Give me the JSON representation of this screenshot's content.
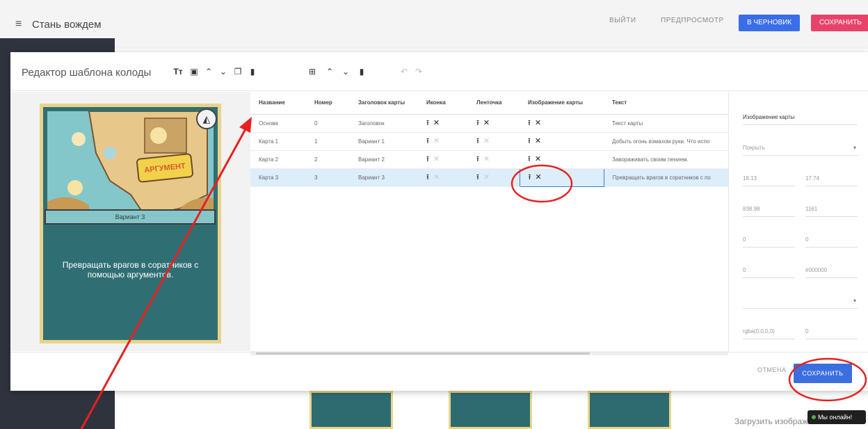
{
  "app": {
    "menu_icon": "menu-icon",
    "title": "Стань вождем",
    "exit_label": "ВЫЙТИ",
    "preview_label": "ПРЕДПРОСМОТР",
    "draft_label": "В ЧЕРНОВИК",
    "save_label": "СОХРАНИТЬ",
    "draft_color": "#3a6ee8",
    "save_color": "#e8426b"
  },
  "background": {
    "upload_caption": "Загрузить изображение",
    "chat_badge": "Мы онлайн!"
  },
  "modal": {
    "title": "Редактор шаблона колоды",
    "toolbar_left": [
      "text-format-icon",
      "image-icon",
      "move-up-icon",
      "move-down-icon",
      "copy-icon",
      "delete-icon"
    ],
    "toolbar_right": [
      "add-card-icon",
      "move-up-icon",
      "move-down-icon",
      "delete-icon",
      "undo-icon",
      "redo-icon"
    ],
    "cancel_label": "ОТМЕНА",
    "save_label": "СОХРАНИТЬ",
    "accent": "#3b6fe0"
  },
  "card_preview": {
    "ribbon": "Вариант 3",
    "text": "Превращать врагов в соратников с помощью аргументов.",
    "tag": "АРГУМЕНТ"
  },
  "table": {
    "columns": [
      "Название",
      "Номер",
      "Заголовок карты",
      "Иконка",
      "Ленточка",
      "Изображение карты",
      "Текст"
    ],
    "rows": [
      {
        "name": "Основа",
        "number": "0",
        "header": "Заголовок",
        "text": "Текст карты"
      },
      {
        "name": "Карта 1",
        "number": "1",
        "header": "Вариант 1",
        "text": "Добыть огонь взмахом руки. Что испо"
      },
      {
        "name": "Карта 2",
        "number": "2",
        "header": "Вариант 2",
        "text": "Завораживать своим пением."
      },
      {
        "name": "Карта 3",
        "number": "3",
        "header": "Вариант 3",
        "text": "Превращать врагов в соратников с по"
      }
    ],
    "selected_row": 3
  },
  "properties": {
    "element_value": "Изображение карты",
    "fit_value": "Покрыть",
    "x_value": "18.13",
    "y_value": "17.74",
    "w_value": "838.98",
    "h_value": "1161",
    "r1_value": "0",
    "r2_value": "0",
    "border_value": "0",
    "border_color": "#000000",
    "color_value": "rgba(0,0,0,0)",
    "opacity_value": "0"
  }
}
